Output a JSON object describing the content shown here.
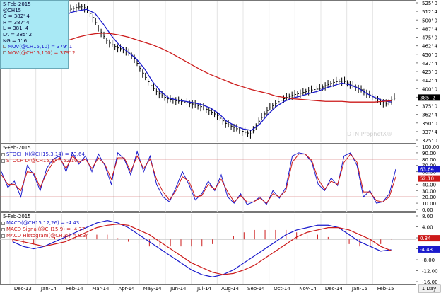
{
  "chart_data": [
    {
      "type": "line",
      "panel": "price",
      "date_label": "5-Feb-2015",
      "symbol": "@CH15",
      "open_label": "O = 382' 4",
      "high_label": "H = 387' 4",
      "low_label": "L = 381' 4",
      "last_label": "LA = 385' 2",
      "ng_label": "NG = 1' 6",
      "legend": [
        "MOV(@CH15,10) = 379' 1",
        "MOV(@CH15,100) = 379' 2"
      ],
      "last_tag": "385' 2",
      "watermark": "DTN ProphetX®",
      "ytick_labels": [
        "525' 0",
        "512' 4",
        "500' 0",
        "487' 4",
        "475' 0",
        "462' 4",
        "450' 0",
        "437' 4",
        "425' 0",
        "412' 4",
        "400' 0",
        "387' 4",
        "375' 0",
        "362' 4",
        "350' 0",
        "337' 4",
        "325' 0"
      ],
      "yrange": [
        321,
        530
      ],
      "series": [
        {
          "name": "MOV(@CH15,10)",
          "color": "#1a1acc",
          "values": [
            440,
            445,
            452,
            462,
            472,
            490,
            505,
            515,
            518,
            520,
            514,
            498,
            480,
            465,
            455,
            445,
            430,
            410,
            395,
            385,
            382,
            380,
            378,
            375,
            370,
            362,
            350,
            343,
            338,
            336,
            345,
            360,
            372,
            380,
            385,
            388,
            392,
            395,
            400,
            404,
            408,
            405,
            400,
            392,
            386,
            381,
            379
          ]
        },
        {
          "name": "MOV(@CH15,100)",
          "color": "#cc1a1a",
          "values": [
            480,
            473,
            466,
            462,
            463,
            466,
            470,
            474,
            478,
            481,
            483,
            484,
            483,
            481,
            478,
            474,
            470,
            466,
            461,
            455,
            448,
            441,
            434,
            427,
            421,
            416,
            411,
            406,
            402,
            398,
            395,
            392,
            388,
            386,
            384,
            383,
            382,
            381,
            380,
            380,
            380,
            379,
            379,
            379,
            379,
            380,
            381
          ]
        },
        {
          "name": "price",
          "color": "#000000",
          "values": [
            462,
            458,
            470,
            478,
            482,
            495,
            508,
            518,
            522,
            525,
            512,
            488,
            470,
            462,
            458,
            448,
            425,
            405,
            392,
            384,
            381,
            379,
            376,
            372,
            366,
            358,
            346,
            340,
            334,
            330,
            352,
            368,
            378,
            385,
            390,
            393,
            397,
            399,
            405,
            410,
            411,
            404,
            398,
            390,
            382,
            376,
            385
          ]
        }
      ]
    },
    {
      "type": "line",
      "panel": "stochastic",
      "date_label": "5-Feb-2015",
      "legend": [
        "STOCH K(@CH15,3,14) = 63.64",
        "STOCH D(@CH15,3) = 52.10"
      ],
      "tags": [
        "63.64",
        "52.10"
      ],
      "ytick_labels": [
        "100.00",
        "90.00",
        "80.00",
        "70.00",
        "60.00",
        "50.00",
        "40.00",
        "30.00",
        "20.00",
        "10.00",
        "0.00"
      ],
      "yrange": [
        0,
        100
      ],
      "reference_lines": [
        80,
        20
      ],
      "series": [
        {
          "name": "STOCH K(@CH15,3,14)",
          "color": "#1a1acc",
          "values": [
            60,
            35,
            45,
            20,
            70,
            55,
            30,
            65,
            80,
            85,
            60,
            90,
            72,
            85,
            60,
            88,
            70,
            40,
            90,
            80,
            55,
            92,
            60,
            85,
            40,
            20,
            12,
            35,
            60,
            40,
            15,
            25,
            45,
            30,
            55,
            20,
            10,
            25,
            8,
            12,
            20,
            8,
            30,
            18,
            35,
            85,
            90,
            88,
            75,
            40,
            30,
            50,
            38,
            85,
            90,
            70,
            20,
            30,
            10,
            12,
            25,
            64
          ]
        },
        {
          "name": "STOCH D(@CH15,3)",
          "color": "#cc1a1a",
          "values": [
            55,
            40,
            40,
            30,
            60,
            58,
            35,
            58,
            75,
            82,
            65,
            85,
            75,
            80,
            65,
            82,
            72,
            48,
            82,
            82,
            60,
            85,
            65,
            80,
            48,
            28,
            15,
            30,
            52,
            45,
            20,
            22,
            40,
            32,
            48,
            28,
            12,
            22,
            12,
            12,
            18,
            10,
            25,
            20,
            30,
            75,
            88,
            88,
            78,
            48,
            32,
            45,
            40,
            75,
            88,
            75,
            28,
            28,
            14,
            12,
            20,
            52
          ]
        }
      ]
    },
    {
      "type": "line",
      "panel": "macd",
      "date_label": "5-Feb-2015",
      "legend": [
        "MACD(@CH15,12,26) = -4.43",
        "MACD Signal(@CH15,9) = -4.77",
        "MACD Histogram(@CH15) = 0.34"
      ],
      "tags": [
        "0.34",
        "-4.43"
      ],
      "ytick_labels": [
        "8.00",
        "4.00",
        "0.00",
        "-4.00",
        "-8.00",
        "-12.00",
        "-16.00"
      ],
      "yrange": [
        -18,
        10
      ],
      "series": [
        {
          "name": "MACD(@CH15,12,26)",
          "color": "#1a1acc",
          "values": [
            -1,
            -3,
            -4,
            -3,
            -1,
            1,
            3,
            5,
            7,
            8,
            7,
            5,
            2,
            -1,
            -4,
            -7,
            -10,
            -13,
            -15,
            -16,
            -15,
            -13,
            -10,
            -7,
            -4,
            -1,
            2,
            4,
            5,
            6,
            6,
            5,
            2,
            -1,
            -3,
            -5,
            -4.4
          ]
        },
        {
          "name": "MACD Signal(@CH15,9)",
          "color": "#cc1a1a",
          "values": [
            0,
            -1,
            -2,
            -3,
            -2,
            -1,
            1,
            3,
            5,
            6,
            6.5,
            6,
            4,
            2,
            -1,
            -4,
            -7,
            -10,
            -12,
            -14,
            -15,
            -14.5,
            -13,
            -11,
            -8,
            -5,
            -2,
            1,
            3,
            4,
            5,
            5,
            4,
            2,
            0,
            -3,
            -4.8
          ]
        },
        {
          "name": "MACD Histogram(@CH15)",
          "color": "#cc1a1a",
          "values": [
            -1,
            -2,
            -2,
            0,
            1,
            2,
            2,
            2,
            2,
            2,
            0.5,
            -1,
            -2,
            -3,
            -3,
            -3,
            -3,
            -3,
            -3,
            -2,
            0,
            1.5,
            3,
            4,
            4,
            4,
            4,
            3,
            2,
            2,
            1,
            0,
            -2,
            -3,
            -3,
            -2,
            0.34
          ]
        }
      ]
    }
  ],
  "xaxis": {
    "months": [
      "Dec-13",
      "Jan-14",
      "Feb-14",
      "Mar-14",
      "Apr-14",
      "May-14",
      "Jun-14",
      "Jul-14",
      "Aug-14",
      "Sep-14",
      "Oct-14",
      "Nov-14",
      "Dec-14",
      "Jan-15",
      "Feb-15"
    ],
    "period_button": "1 Day"
  },
  "colors": {
    "infobox_bg": "#a9e9f5",
    "blue": "#1a1acc",
    "red": "#cc1a1a",
    "ref_line": "#cc5555"
  }
}
